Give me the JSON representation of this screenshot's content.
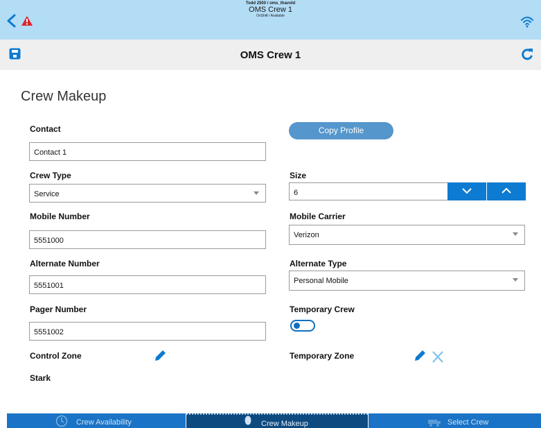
{
  "topbar": {
    "user": "Todd 2500 / oms_thavold",
    "crew": "OMS Crew 1",
    "status": "OnShift / Available"
  },
  "toolbar": {
    "title": "OMS Crew 1"
  },
  "page": {
    "section_title": "Crew Makeup"
  },
  "form": {
    "contact_label": "Contact",
    "contact_value": "Contact 1",
    "copy_profile_label": "Copy Profile",
    "crew_type_label": "Crew Type",
    "crew_type_value": "Service",
    "size_label": "Size",
    "size_value": "6",
    "mobile_number_label": "Mobile Number",
    "mobile_number_value": "5551000",
    "mobile_carrier_label": "Mobile Carrier",
    "mobile_carrier_value": "Verizon",
    "alternate_number_label": "Alternate Number",
    "alternate_number_value": "5551001",
    "alternate_type_label": "Alternate Type",
    "alternate_type_value": "Personal Mobile",
    "pager_number_label": "Pager Number",
    "pager_number_value": "5551002",
    "temporary_crew_label": "Temporary Crew",
    "temporary_crew_on": false,
    "control_zone_label": "Control Zone",
    "control_zone_value": "Stark",
    "temporary_zone_label": "Temporary Zone"
  },
  "tabs": {
    "availability": "Crew Availability",
    "makeup": "Crew Makeup",
    "select": "Select Crew"
  },
  "icons": {
    "back": "chevron-left-icon",
    "warning": "warning-icon",
    "wifi": "wifi-icon",
    "save": "save-icon",
    "refresh": "refresh-icon",
    "edit": "pencil-icon",
    "clear": "close-icon",
    "clock": "clock-icon",
    "person": "person-icon",
    "crew": "truck-icon"
  },
  "colors": {
    "topbar": "#b3dcf5",
    "accent": "#0d7bd1",
    "copy_button": "#5596cc",
    "warning": "#d9262b",
    "tab": "#1a73c6",
    "tab_active": "#0d4a80"
  }
}
